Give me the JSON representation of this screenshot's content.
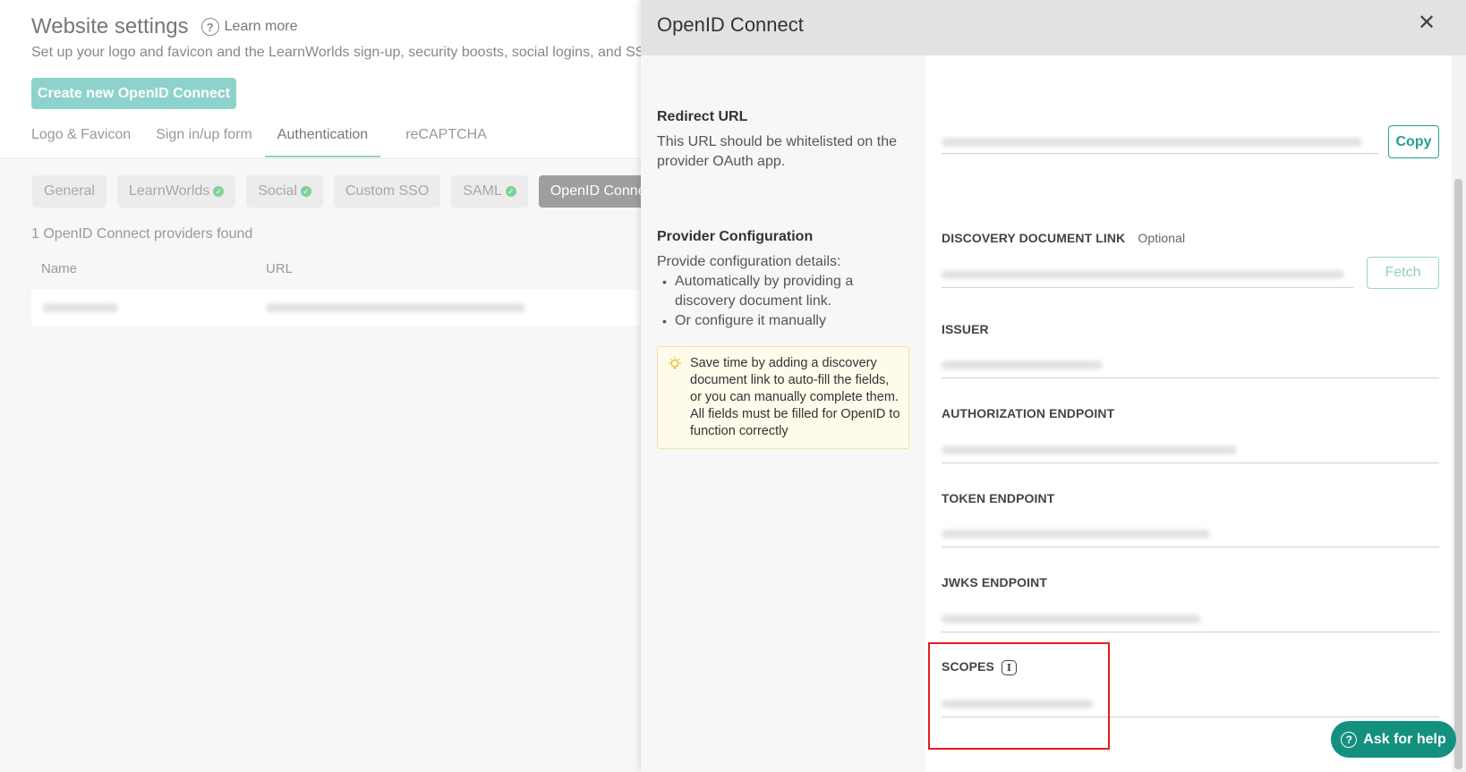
{
  "background": {
    "title": "Website settings",
    "learn_more": "Learn more",
    "subtitle": "Set up your logo and favicon and the LearnWorlds sign-up, security boosts, social logins, and SSO.",
    "create_button": "Create new OpenID Connect",
    "tabs": [
      "Logo & Favicon",
      "Sign in/up form",
      "Authentication",
      "reCAPTCHA"
    ],
    "active_tab": "Authentication",
    "pills": [
      {
        "label": "General",
        "check": false
      },
      {
        "label": "LearnWorlds",
        "check": true
      },
      {
        "label": "Social",
        "check": true
      },
      {
        "label": "Custom SSO",
        "check": false
      },
      {
        "label": "SAML",
        "check": true
      },
      {
        "label": "OpenID Conne",
        "check": false
      }
    ],
    "providers_found": "1 OpenID Connect providers found",
    "columns": [
      "Name",
      "URL"
    ]
  },
  "panel": {
    "title": "OpenID Connect",
    "close_icon": "close-icon",
    "redirect": {
      "title": "Redirect URL",
      "description": "This URL should be whitelisted on the provider OAuth app.",
      "copy_button": "Copy"
    },
    "provider": {
      "title": "Provider Configuration",
      "intro": "Provide configuration details:",
      "bullets": [
        "Automatically by providing a discovery document link.",
        "Or configure it manually"
      ],
      "tip": "Save time by adding a discovery document link to auto-fill the fields, or you can manually complete them. All fields must be filled for OpenID to function correctly",
      "tip_icon": "lightbulb-icon"
    },
    "fields": {
      "discovery_label": "DISCOVERY DOCUMENT LINK",
      "discovery_optional": "Optional",
      "fetch_button": "Fetch",
      "issuer_label": "ISSUER",
      "authorization_label": "AUTHORIZATION ENDPOINT",
      "token_label": "TOKEN ENDPOINT",
      "jwks_label": "JWKS ENDPOINT",
      "scopes_label": "SCOPES",
      "scopes_icon": "info-icon"
    }
  },
  "ask_help": "Ask for help",
  "colors": {
    "accent": "#14907f",
    "highlight": "#e11d1d",
    "tip_bg": "#fffbea"
  }
}
